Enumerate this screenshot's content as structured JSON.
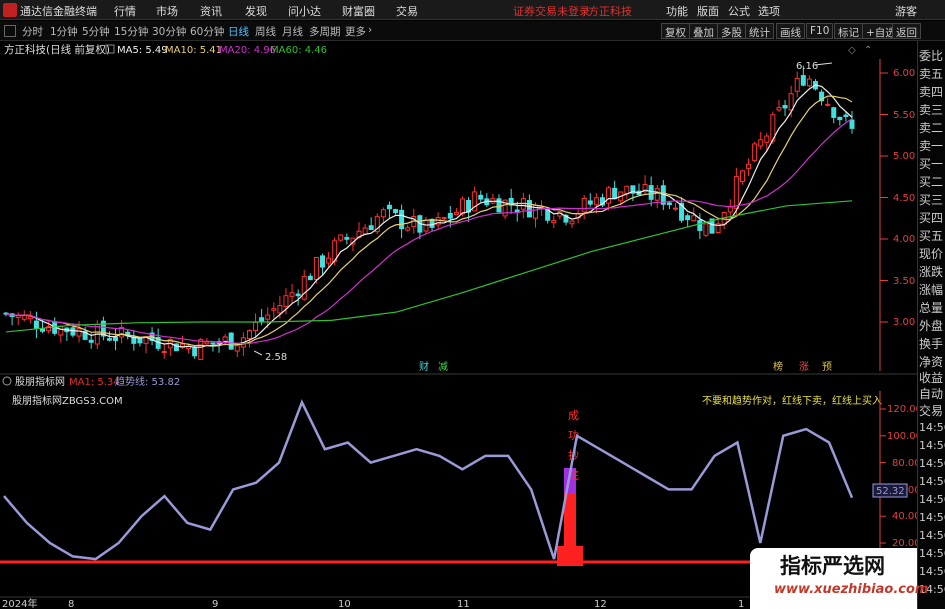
{
  "titlebar": {
    "app_title": "通达信金融终端",
    "menu": [
      "行情",
      "市场",
      "资讯",
      "发现",
      "问小达",
      "财富圈",
      "交易"
    ],
    "status": "证券交易未登录",
    "broker": "方正科技",
    "right_menu": [
      "功能",
      "版面",
      "公式",
      "选项"
    ],
    "guest": "游客"
  },
  "toolbar": {
    "periods": [
      "分时",
      "1分钟",
      "5分钟",
      "15分钟",
      "30分钟",
      "60分钟",
      "日线",
      "周线",
      "月线",
      "多周期",
      "更多"
    ],
    "active_period": "日线",
    "buttons": [
      "复权",
      "叠加",
      "多股",
      "统计",
      "画线",
      "F10",
      "标记",
      "+自选",
      "返回"
    ]
  },
  "main_panel": {
    "stock_label": "方正科技(日线 前复权)",
    "ma5": "MA5: 5.49",
    "ma10": "MA10: 5.41",
    "ma20": "MA20: 4.96",
    "ma60": "MA60: 4.46",
    "high_annotation": "6.16",
    "low_annotation": "2.58",
    "y_ticks": [
      "6.00",
      "5.50",
      "5.00",
      "4.50",
      "4.00",
      "3.50",
      "3.00"
    ],
    "markers": [
      {
        "text": "财",
        "color": "#3dd6d6"
      },
      {
        "text": "减",
        "color": "#3dd64a"
      },
      {
        "text": "榜",
        "color": "#e0c040"
      },
      {
        "text": "涨",
        "color": "#e05050"
      },
      {
        "text": "预",
        "color": "#e0c040"
      }
    ]
  },
  "indicator_panel": {
    "name": "股朋指标网",
    "ma1": "MA1: 5.34",
    "trend": "趋势线: 53.82",
    "source": "股朋指标网ZBGS3.COM",
    "tip": "不要和趋势作对，红线下卖，红线上买入",
    "signal_text": [
      "成",
      "功",
      "抄",
      "底"
    ],
    "current_value": "52.32",
    "y_ticks": [
      "120.00",
      "100.00",
      "80.00",
      "60.00",
      "40.00",
      "20.00"
    ]
  },
  "x_axis": {
    "labels": [
      "2024年",
      "8",
      "9",
      "10",
      "11",
      "12",
      "1"
    ]
  },
  "right_panel": {
    "items": [
      "委比",
      "卖五",
      "卖四",
      "卖三",
      "卖二",
      "卖一",
      "买一",
      "买二",
      "买三",
      "买四",
      "买五",
      "现价",
      "涨跌",
      "涨幅",
      "总量",
      "外盘",
      "换手",
      "净资",
      "收益"
    ],
    "lower_items": [
      "自动",
      "交易",
      "14:56",
      "14:56",
      "14:56",
      "14:56",
      "14:56",
      "14:56",
      "14:56",
      "14:56",
      "14:56",
      "14:56"
    ]
  },
  "watermark": {
    "title": "指标严选网",
    "url": "www.xuezhibiao.com"
  },
  "chart_data": [
    {
      "type": "candlestick",
      "title": "方正科技(日线 前复权)",
      "ylim": [
        2.5,
        6.3
      ],
      "series": [
        {
          "name": "MA5",
          "color": "#f0f0f0"
        },
        {
          "name": "MA10",
          "color": "#e8d070"
        },
        {
          "name": "MA20",
          "color": "#d030d0"
        },
        {
          "name": "MA60",
          "color": "#30c030"
        }
      ],
      "ma60_values": [
        2.88,
        2.96,
        2.99,
        3.0,
        3.0,
        3.02,
        3.12,
        3.35,
        3.6,
        3.85,
        4.05,
        4.25,
        4.4,
        4.46
      ],
      "close_values": [
        3.1,
        2.95,
        2.85,
        2.8,
        2.7,
        2.8,
        3.3,
        3.9,
        4.3,
        4.1,
        4.5,
        4.4,
        4.3,
        4.6,
        4.5,
        4.1,
        5.1,
        6.0,
        5.3
      ]
    },
    {
      "type": "line",
      "title": "股朋指标网",
      "ylim": [
        0,
        130
      ],
      "series": [
        {
          "name": "趋势线",
          "color": "#9a9ad8",
          "values": [
            55,
            35,
            20,
            10,
            8,
            20,
            40,
            55,
            35,
            30,
            60,
            65,
            80,
            125,
            90,
            95,
            80,
            85,
            90,
            85,
            75,
            85,
            85,
            60,
            8,
            100,
            90,
            80,
            70,
            60,
            60,
            85,
            95,
            20,
            100,
            105,
            95,
            53.82
          ]
        },
        {
          "name": "MA1",
          "color": "#ff2020",
          "values": [
            10,
            10
          ]
        }
      ]
    }
  ]
}
